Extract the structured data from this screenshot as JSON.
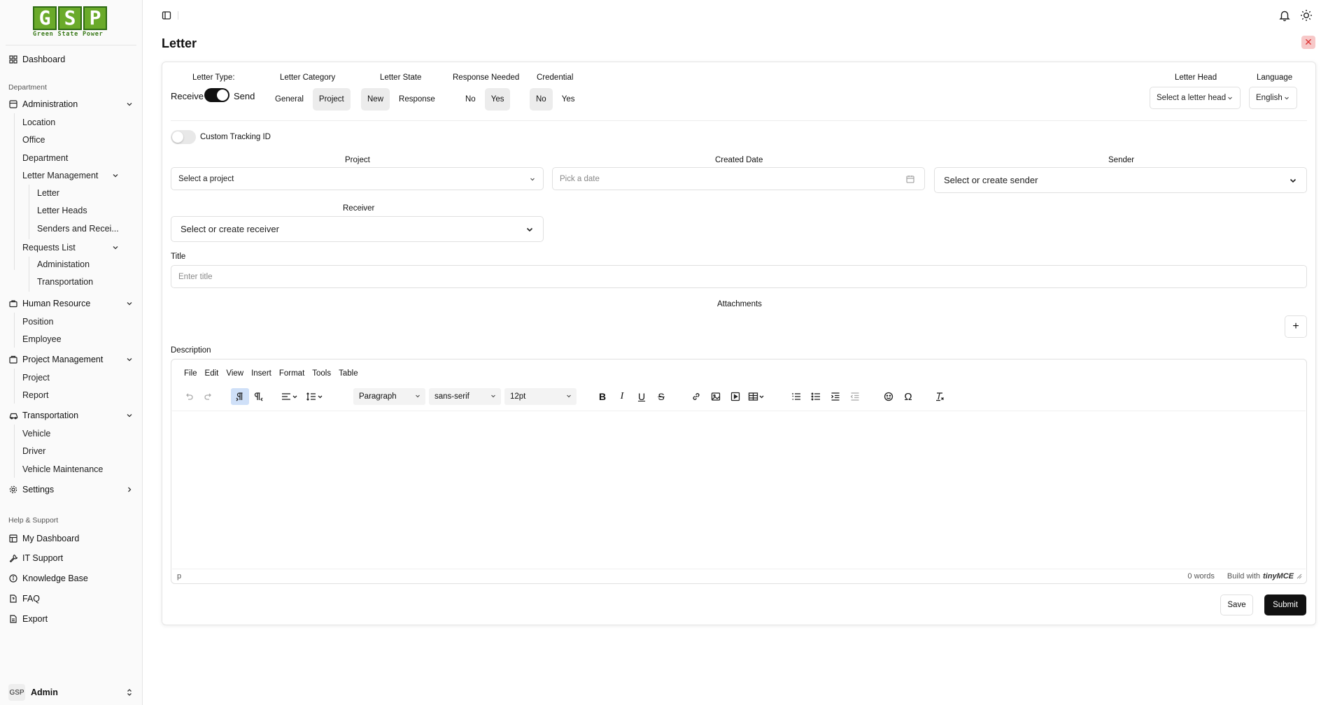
{
  "brand": {
    "logo_letters": [
      "G",
      "S",
      "P"
    ],
    "logo_sub": "Green State Power"
  },
  "sidebar": {
    "dashboard": "Dashboard",
    "department_label": "Department",
    "administration": "Administration",
    "admin_items": [
      "Location",
      "Office",
      "Department"
    ],
    "letter_management": "Letter Management",
    "letter_items": [
      "Letter",
      "Letter Heads",
      "Senders and Recei..."
    ],
    "requests_list": "Requests List",
    "request_items": [
      "Administation",
      "Transportation"
    ],
    "human_resource": "Human Resource",
    "hr_items": [
      "Position",
      "Employee"
    ],
    "project_management": "Project Management",
    "pm_items": [
      "Project",
      "Report"
    ],
    "transportation": "Transportation",
    "transport_items": [
      "Vehicle",
      "Driver",
      "Vehicle Maintenance"
    ],
    "settings": "Settings",
    "help_label": "Help & Support",
    "help_items": [
      "My Dashboard",
      "IT Support",
      "Knowledge Base",
      "FAQ",
      "Export"
    ],
    "user_avatar": "GSP",
    "user_name": "Admin"
  },
  "page": {
    "title": "Letter"
  },
  "form": {
    "letter_type_label": "Letter Type:",
    "letter_type_receive": "Receive",
    "letter_type_send": "Send",
    "letter_type_value": "Send",
    "letter_category_label": "Letter Category",
    "letter_category_options": [
      "General",
      "Project"
    ],
    "letter_category_selected": "Project",
    "letter_state_label": "Letter State",
    "letter_state_options": [
      "New",
      "Response"
    ],
    "letter_state_selected": "New",
    "response_needed_label": "Response Needed",
    "response_needed_options": [
      "No",
      "Yes"
    ],
    "response_needed_selected": "Yes",
    "credential_label": "Credential",
    "credential_options": [
      "No",
      "Yes"
    ],
    "credential_selected": "No",
    "letter_head_label": "Letter Head",
    "letter_head_placeholder": "Select a letter head",
    "language_label": "Language",
    "language_value": "English",
    "custom_tracking_label": "Custom Tracking ID",
    "custom_tracking_on": false,
    "project_label": "Project",
    "project_placeholder": "Select a project",
    "created_date_label": "Created Date",
    "created_date_placeholder": "Pick a date",
    "sender_label": "Sender",
    "sender_placeholder": "Select or create sender",
    "receiver_label": "Receiver",
    "receiver_placeholder": "Select or create receiver",
    "title_label": "Title",
    "title_placeholder": "Enter title",
    "attachments_label": "Attachments",
    "description_label": "Description"
  },
  "editor": {
    "menu": [
      "File",
      "Edit",
      "View",
      "Insert",
      "Format",
      "Tools",
      "Table"
    ],
    "block_format": "Paragraph",
    "font_family": "sans-serif",
    "font_size": "12pt",
    "status_path": "p",
    "word_count": "0 words",
    "build_with": "Build with",
    "brand": "tinyMCE"
  },
  "actions": {
    "save": "Save",
    "submit": "Submit"
  }
}
